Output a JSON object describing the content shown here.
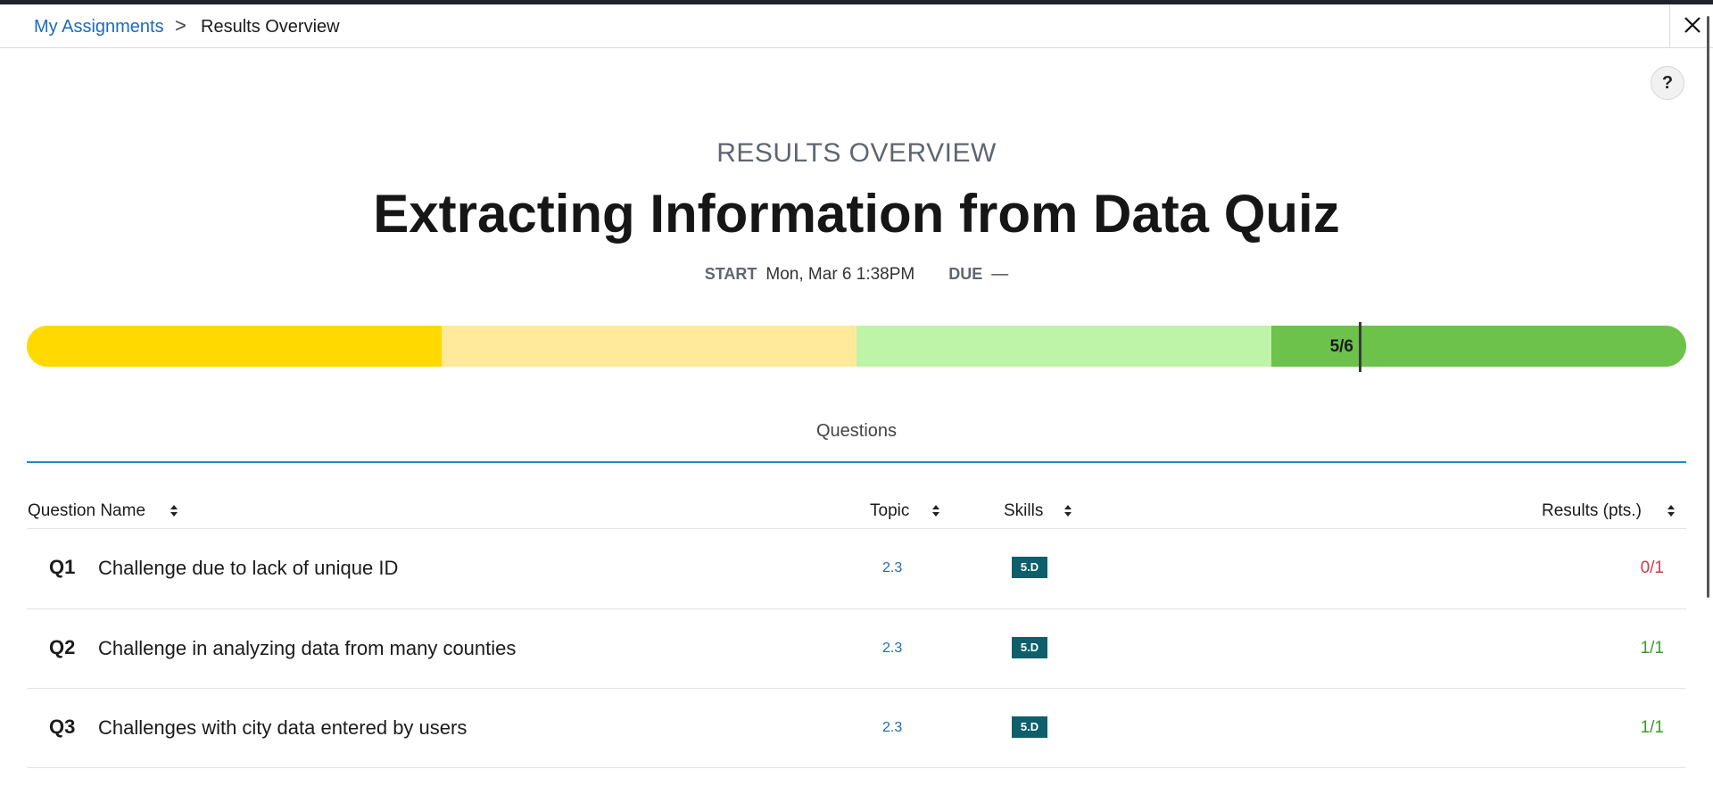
{
  "breadcrumb": {
    "parent": "My Assignments",
    "separator": ">",
    "current": "Results Overview"
  },
  "help": {
    "label": "?"
  },
  "header": {
    "eyebrow": "RESULTS OVERVIEW",
    "title": "Extracting Information from Data Quiz",
    "start_label": "START",
    "start_value": "Mon, Mar 6 1:38PM",
    "due_label": "DUE",
    "due_value": "—"
  },
  "score": {
    "label": "5/6",
    "earned": 5,
    "total": 6,
    "band_colors": [
      "#ffd900",
      "#ffe99a",
      "#bef4a8",
      "#6cc24a"
    ]
  },
  "tabs": [
    {
      "label": "Questions",
      "active": true
    }
  ],
  "table": {
    "headers": {
      "name": "Question Name",
      "topic": "Topic",
      "skills": "Skills",
      "results": "Results (pts.)"
    },
    "rows": [
      {
        "num": "Q1",
        "name": "Challenge due to lack of unique ID",
        "topic": "2.3",
        "skill": "5.D",
        "result": "0/1",
        "status": "incorrect"
      },
      {
        "num": "Q2",
        "name": "Challenge in analyzing data from many counties",
        "topic": "2.3",
        "skill": "5.D",
        "result": "1/1",
        "status": "correct"
      },
      {
        "num": "Q3",
        "name": "Challenges with city data entered by users",
        "topic": "2.3",
        "skill": "5.D",
        "result": "1/1",
        "status": "correct"
      }
    ]
  },
  "colors": {
    "link": "#1a6bbd",
    "incorrect": "#d6374f",
    "correct": "#3a9a2b",
    "skill_badge": "#0c5f6b",
    "tab_underline": "#1e88c9"
  }
}
